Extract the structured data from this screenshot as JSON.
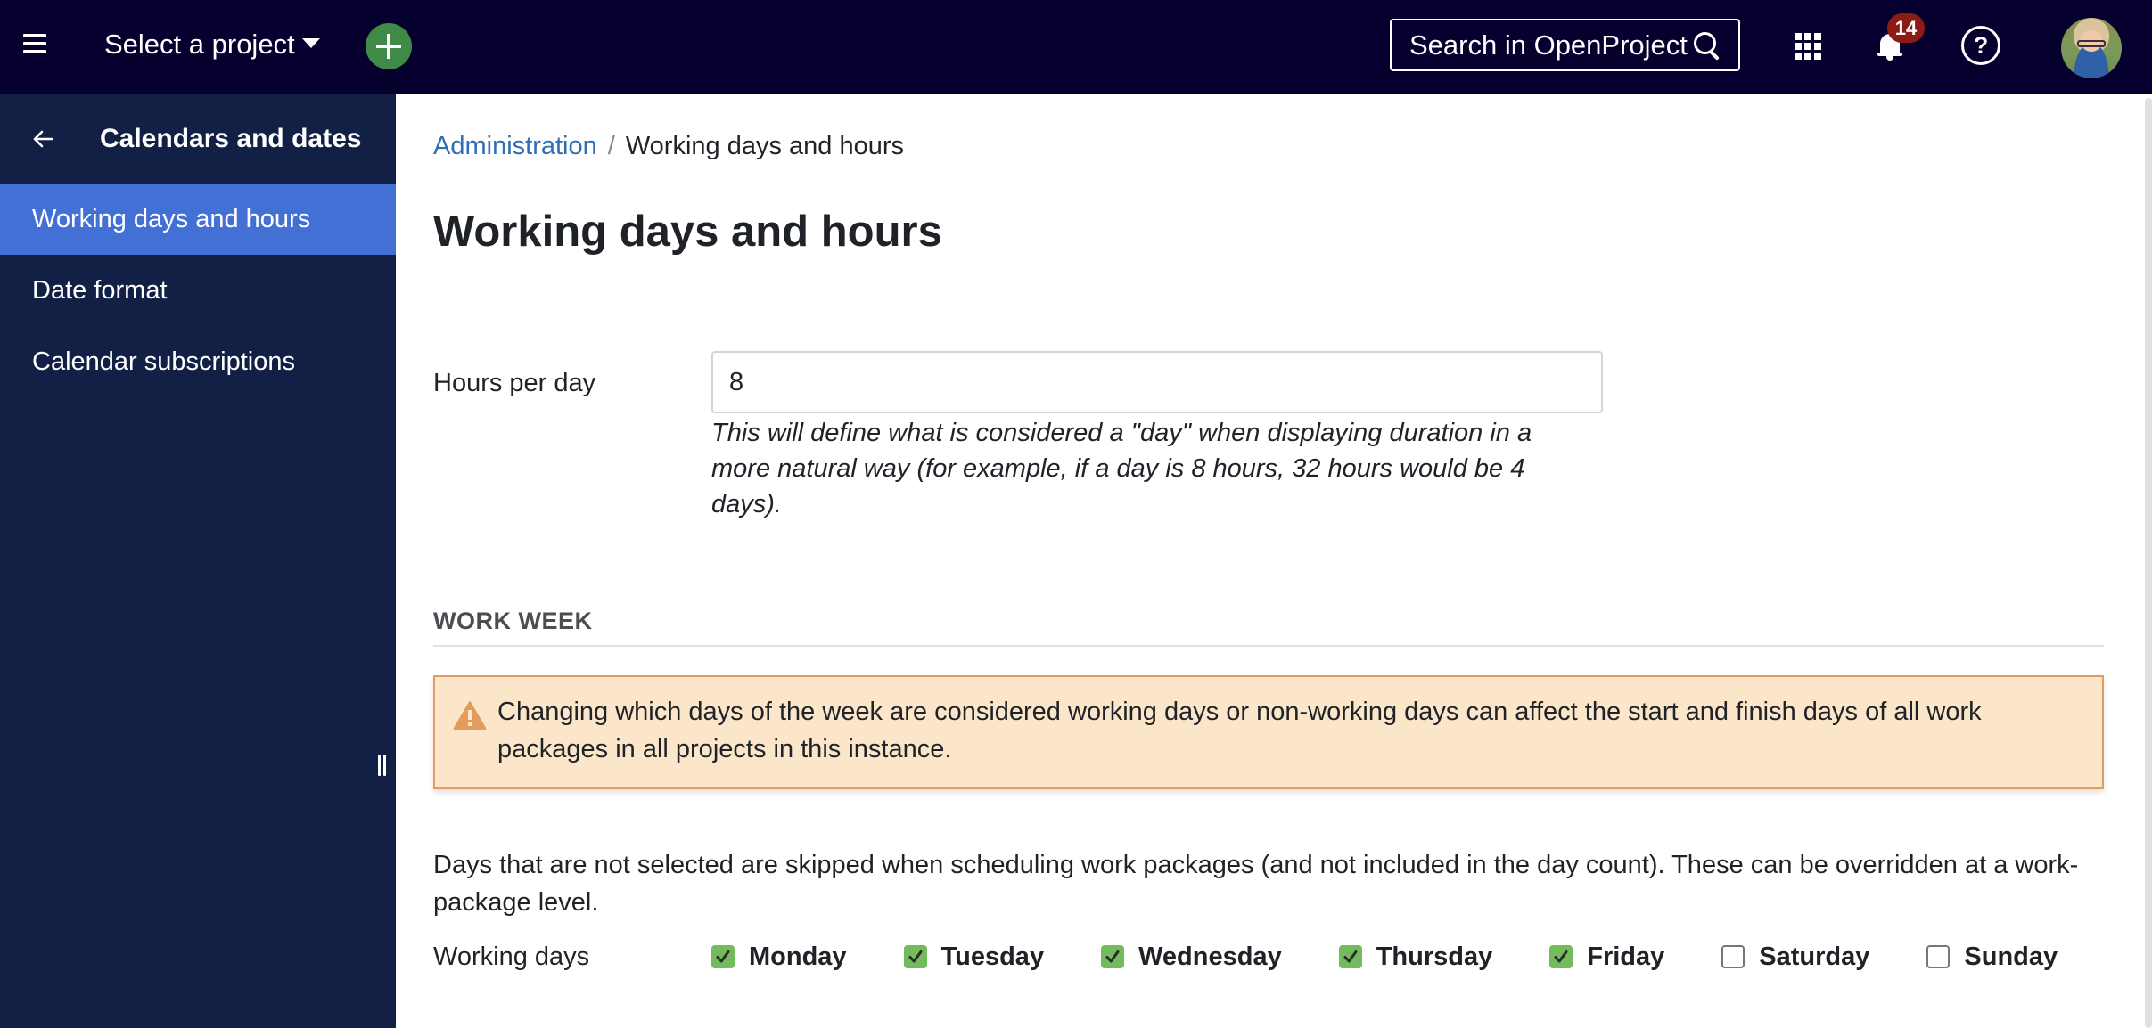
{
  "header": {
    "project_select_label": "Select a project",
    "search_label": "Search in OpenProject",
    "notification_count": "14",
    "help_glyph": "?",
    "icons": {
      "menu": "hamburger-icon",
      "add": "plus-icon",
      "search": "search-icon",
      "modules": "grid-icon",
      "notifications": "bell-icon",
      "help": "help-icon",
      "avatar": "user-avatar"
    },
    "colors": {
      "background": "#05002e",
      "add_button": "#3f8a46",
      "badge": "#8b1c13"
    }
  },
  "sidebar": {
    "title": "Calendars and dates",
    "back_icon": "arrow-left-icon",
    "items": [
      {
        "label": "Working days and hours",
        "active": true
      },
      {
        "label": "Date format",
        "active": false
      },
      {
        "label": "Calendar subscriptions",
        "active": false
      }
    ],
    "colors": {
      "background": "#132045",
      "active": "#4270d5"
    }
  },
  "breadcrumb": {
    "items": [
      {
        "label": "Administration",
        "link": true
      },
      {
        "label": "Working days and hours",
        "link": false
      }
    ],
    "separator": "/"
  },
  "page": {
    "title": "Working days and hours",
    "hours_per_day": {
      "label": "Hours per day",
      "value": "8",
      "hint": "This will define what is considered a \"day\" when displaying duration in a more natural way (for example, if a day is 8 hours, 32 hours would be 4 days)."
    },
    "work_week": {
      "section_title": "WORK WEEK",
      "warning": "Changing which days of the week are considered working days or non-working days can affect the start and finish days of all work packages in all projects in this instance.",
      "description": "Days that are not selected are skipped when scheduling work packages (and not included in the day count). These can be overridden at a work-package level.",
      "working_days_label": "Working days",
      "days": [
        {
          "label": "Monday",
          "checked": true
        },
        {
          "label": "Tuesday",
          "checked": true
        },
        {
          "label": "Wednesday",
          "checked": true
        },
        {
          "label": "Thursday",
          "checked": true
        },
        {
          "label": "Friday",
          "checked": true
        },
        {
          "label": "Saturday",
          "checked": false
        },
        {
          "label": "Sunday",
          "checked": false
        }
      ]
    },
    "colors": {
      "link": "#2e6eb1",
      "warning_bg": "#fbe6c9",
      "warning_border": "#e49c5e",
      "checkbox_checked": "#74bb5b"
    }
  }
}
